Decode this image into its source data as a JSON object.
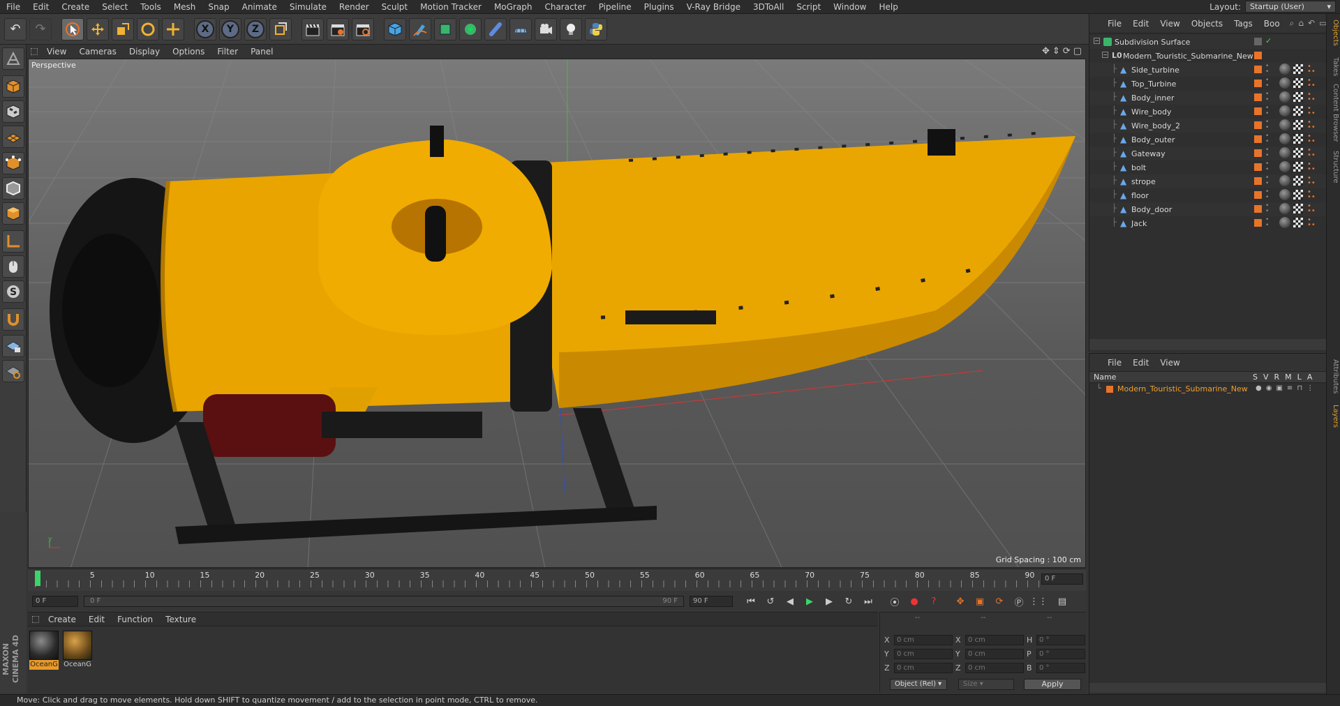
{
  "menubar": {
    "items": [
      "File",
      "Edit",
      "Create",
      "Select",
      "Tools",
      "Mesh",
      "Snap",
      "Animate",
      "Simulate",
      "Render",
      "Sculpt",
      "Motion Tracker",
      "MoGraph",
      "Character",
      "Pipeline",
      "Plugins",
      "V-Ray Bridge",
      "3DToAll",
      "Script",
      "Window",
      "Help"
    ],
    "layout_label": "Layout:",
    "layout_value": "Startup (User)"
  },
  "viewport": {
    "menu": [
      "View",
      "Cameras",
      "Display",
      "Options",
      "Filter",
      "Panel"
    ],
    "label": "Perspective",
    "grid_spacing": "Grid Spacing : 100 cm"
  },
  "timeline": {
    "ticks": [
      "0",
      "5",
      "10",
      "15",
      "20",
      "25",
      "30",
      "35",
      "40",
      "45",
      "50",
      "55",
      "60",
      "65",
      "70",
      "75",
      "80",
      "85",
      "90"
    ],
    "current_frame": "0 F",
    "start_field": "0 F",
    "range_start": "0 F",
    "range_end": "90 F",
    "end_field": "90 F"
  },
  "materials": {
    "menu": [
      "Create",
      "Edit",
      "Function",
      "Texture"
    ],
    "items": [
      {
        "name": "OceanG",
        "selected": true
      },
      {
        "name": "OceanG",
        "selected": false
      }
    ]
  },
  "coords": {
    "header": [
      "--",
      "--",
      "--"
    ],
    "rows": [
      {
        "a": "X",
        "av": "0 cm",
        "b": "X",
        "bv": "0 cm",
        "c": "H",
        "cv": "0 °"
      },
      {
        "a": "Y",
        "av": "0 cm",
        "b": "Y",
        "bv": "0 cm",
        "c": "P",
        "cv": "0 °"
      },
      {
        "a": "Z",
        "av": "0 cm",
        "b": "Z",
        "bv": "0 cm",
        "c": "B",
        "cv": "0 °"
      }
    ],
    "mode": "Object (Rel)",
    "size": "Size",
    "apply": "Apply"
  },
  "objects": {
    "menu": [
      "File",
      "Edit",
      "View",
      "Objects",
      "Tags",
      "Boo"
    ],
    "root": "Subdivision Surface",
    "group": "Modern_Touristic_Submarine_New",
    "children": [
      "Side_turbine",
      "Top_Turbine",
      "Body_inner",
      "Wire_body",
      "Wire_body_2",
      "Body_outer",
      "Gateway",
      "bolt",
      "strope",
      "floor",
      "Body_door",
      "Jack"
    ]
  },
  "layers": {
    "menu": [
      "File",
      "Edit",
      "View"
    ],
    "header_name": "Name",
    "header_cols": [
      "S",
      "V",
      "R",
      "M",
      "L",
      "A"
    ],
    "rows": [
      {
        "name": "Modern_Touristic_Submarine_New",
        "color": "#e8742a"
      }
    ]
  },
  "side_tabs": [
    "Objects",
    "Takes",
    "Content Browser",
    "Structure",
    "Attributes",
    "Layers"
  ],
  "maxon": "MAXON CINEMA 4D",
  "status": "Move: Click and drag to move elements. Hold down SHIFT to quantize movement / add to the selection in point mode, CTRL to remove.",
  "colors": {
    "accent": "#e8742a",
    "sub_yellow": "#e9a400",
    "dark": "#1a1a1a"
  }
}
